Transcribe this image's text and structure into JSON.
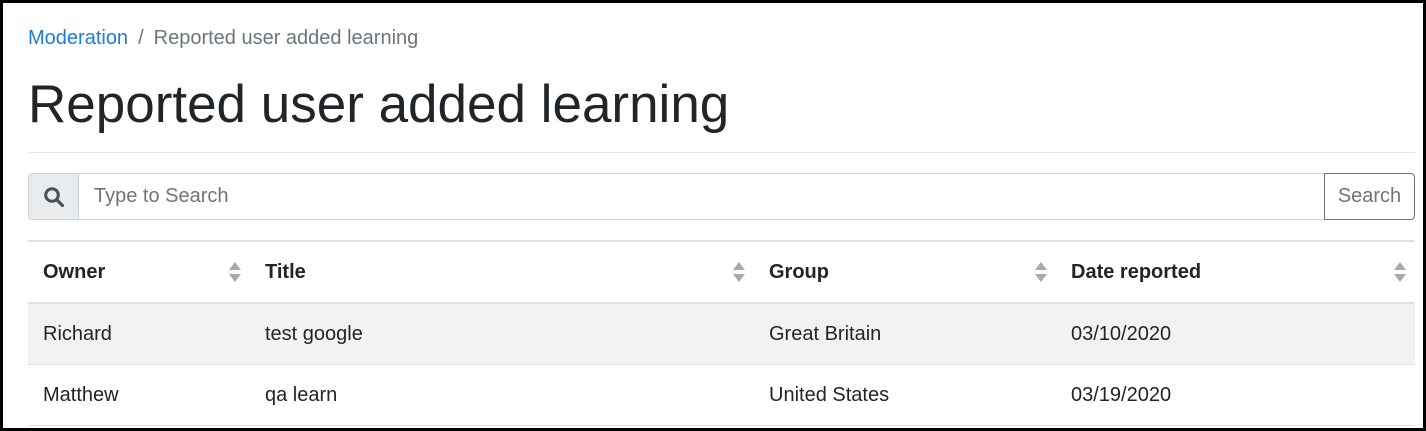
{
  "breadcrumb": {
    "link_label": "Moderation",
    "separator": "/",
    "current": "Reported user added learning"
  },
  "page_title": "Reported user added learning",
  "search": {
    "icon": "search-icon",
    "placeholder": "Type to Search",
    "value": "",
    "button_label": "Search"
  },
  "table": {
    "columns": [
      {
        "label": "Owner",
        "sort_icon": "sort-icon"
      },
      {
        "label": "Title",
        "sort_icon": "sort-icon"
      },
      {
        "label": "Group",
        "sort_icon": "sort-icon"
      },
      {
        "label": "Date reported",
        "sort_icon": "sort-icon"
      }
    ],
    "rows": [
      {
        "owner": "Richard",
        "title": "test google",
        "group": "Great Britain",
        "date": "03/10/2020"
      },
      {
        "owner": "Matthew",
        "title": "qa learn",
        "group": "United States",
        "date": "03/19/2020"
      }
    ]
  },
  "colors": {
    "link": "#1f7ae0",
    "muted": "#6c757d",
    "stripe": "#f2f2f2",
    "text": "#212529"
  }
}
